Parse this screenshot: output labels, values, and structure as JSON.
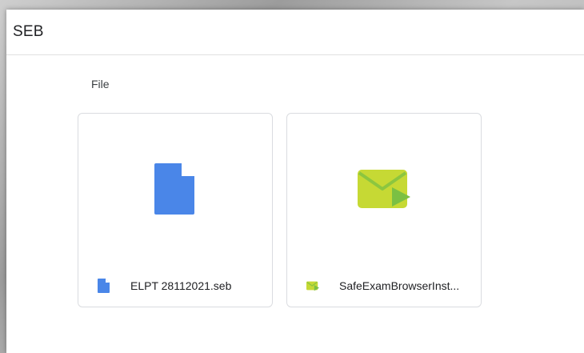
{
  "window": {
    "title": "SEB"
  },
  "section": {
    "label": "File"
  },
  "files": [
    {
      "name": "ELPT 28112021.seb",
      "icon": "document-icon",
      "icon_color": "#4a86e8"
    },
    {
      "name": "SafeExamBrowserInst...",
      "icon": "envelope-play-icon",
      "icon_color": "#c6d934",
      "accent_color": "#7bc043"
    }
  ]
}
